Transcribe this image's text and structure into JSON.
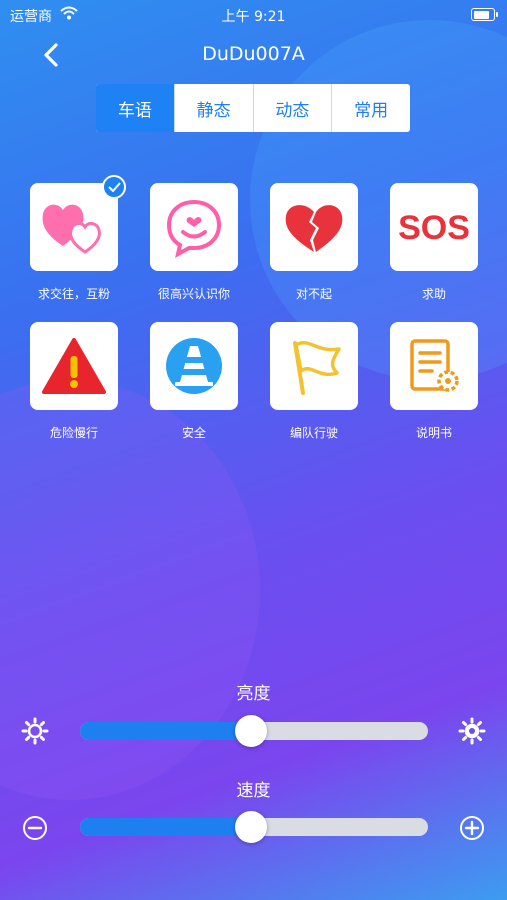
{
  "status_bar": {
    "carrier": "运营商",
    "time": "上午 9:21",
    "battery_level": 0.9
  },
  "header": {
    "title": "DuDu007A",
    "back_icon": "chevron-left-icon"
  },
  "tabs": [
    {
      "label": "车语",
      "active": true
    },
    {
      "label": "静态",
      "active": false
    },
    {
      "label": "动态",
      "active": false
    },
    {
      "label": "常用",
      "active": false
    }
  ],
  "grid": {
    "items": [
      {
        "label": "求交往，互粉",
        "icon": "double-heart-icon",
        "selected": true
      },
      {
        "label": "很高兴认识你",
        "icon": "smiley-chat-icon",
        "selected": false
      },
      {
        "label": "对不起",
        "icon": "broken-heart-icon",
        "selected": false
      },
      {
        "label": "求助",
        "icon": "sos-icon",
        "icon_text": "SOS",
        "selected": false
      },
      {
        "label": "危险慢行",
        "icon": "warning-icon",
        "selected": false
      },
      {
        "label": "安全",
        "icon": "traffic-cone-icon",
        "selected": false
      },
      {
        "label": "编队行驶",
        "icon": "flag-icon",
        "selected": false
      },
      {
        "label": "说明书",
        "icon": "manual-icon",
        "selected": false
      }
    ]
  },
  "brightness": {
    "label": "亮度",
    "value": 0.49
  },
  "speed": {
    "label": "速度",
    "value": 0.49
  },
  "colors": {
    "accent": "#1e82f5",
    "track": "#d9dde3"
  }
}
